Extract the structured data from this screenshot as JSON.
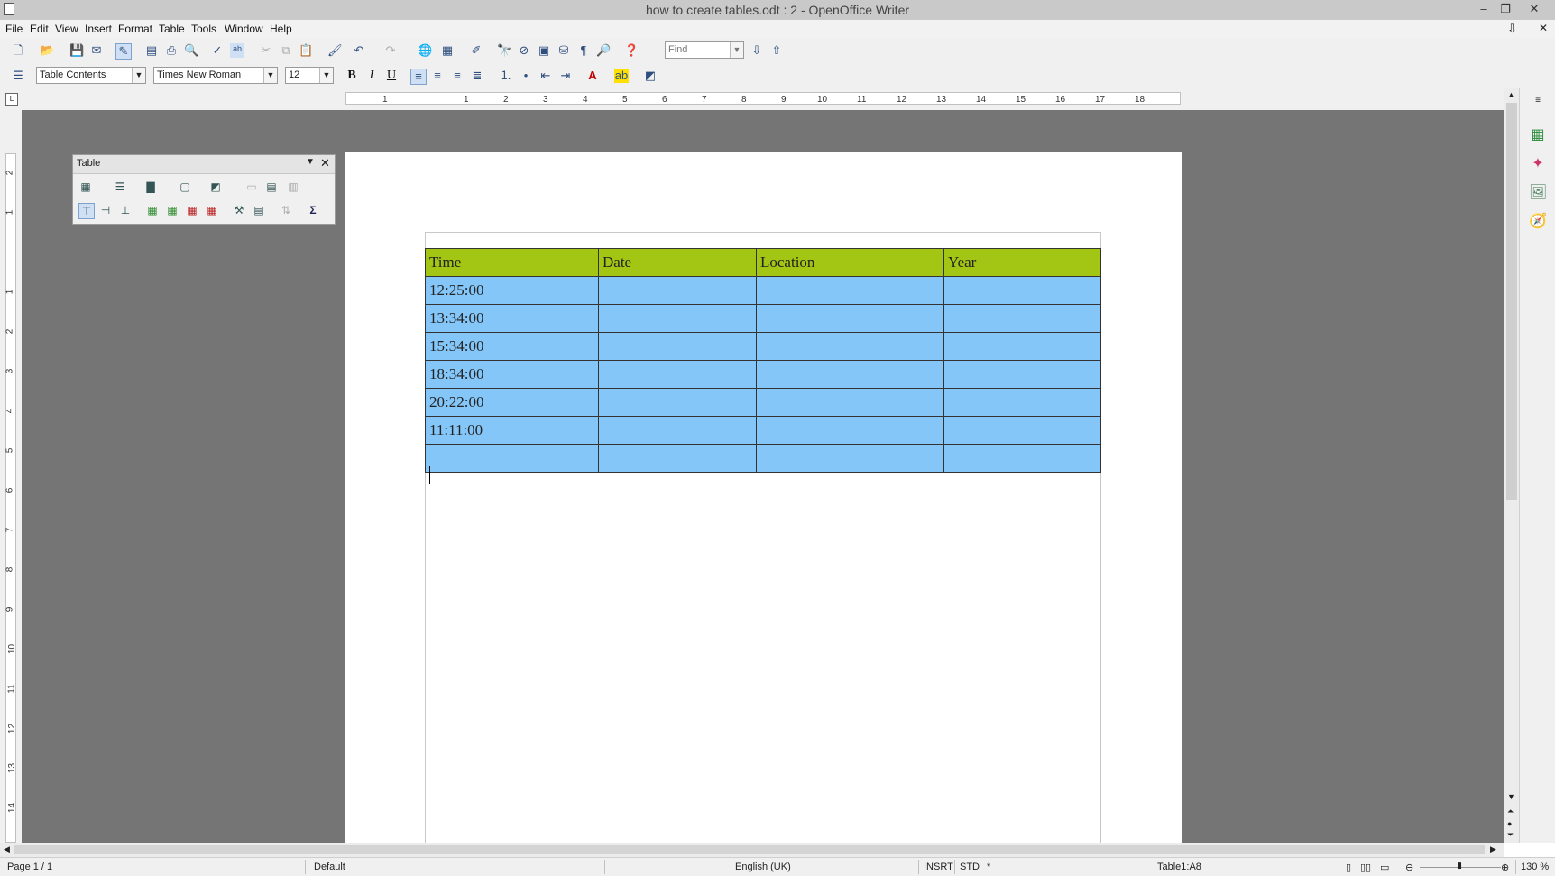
{
  "window": {
    "title": "how to create tables.odt : 2 - OpenOffice Writer",
    "minimize": "–",
    "restore": "❐",
    "close": "✕"
  },
  "menu": [
    "File",
    "Edit",
    "View",
    "Insert",
    "Format",
    "Table",
    "Tools",
    "Window",
    "Help"
  ],
  "toolbar": {
    "find_placeholder": "Find"
  },
  "formatting": {
    "style": "Table Contents",
    "font": "Times New Roman",
    "size": "12",
    "bold": "B",
    "italic": "I",
    "underline": "U"
  },
  "ruler": {
    "h_numbers": [
      "1",
      "1",
      "2",
      "3",
      "4",
      "5",
      "6",
      "7",
      "8",
      "9",
      "10",
      "11",
      "12",
      "13",
      "14",
      "15",
      "16",
      "17",
      "18"
    ],
    "v_numbers": [
      "2",
      "1",
      "1",
      "2",
      "3",
      "4",
      "5",
      "6",
      "7",
      "8",
      "9",
      "10",
      "11",
      "12",
      "13",
      "14"
    ]
  },
  "table_toolbar": {
    "title": "Table",
    "sum_icon": "Σ"
  },
  "document": {
    "headers": [
      "Time",
      "Date",
      "Location",
      "Year"
    ],
    "rows": [
      [
        "12:25:00",
        "",
        "",
        ""
      ],
      [
        "13:34:00",
        "",
        "",
        ""
      ],
      [
        "15:34:00",
        "",
        "",
        ""
      ],
      [
        "18:34:00",
        "",
        "",
        ""
      ],
      [
        "20:22:00",
        "",
        "",
        ""
      ],
      [
        "11:11:00",
        "",
        "",
        ""
      ],
      [
        "",
        "",
        "",
        ""
      ]
    ]
  },
  "status": {
    "page": "Page 1 / 1",
    "style": "Default",
    "language": "English (UK)",
    "insert_mode": "INSRT",
    "selection_mode": "STD",
    "modified": "*",
    "cell": "Table1:A8",
    "zoom": "130 %"
  },
  "colors": {
    "header_row": "#a3c514",
    "body_rows": "#84c6f8",
    "workspace": "#757575"
  },
  "icons": [
    "new-doc-icon",
    "open-icon",
    "save-icon",
    "email-icon",
    "edit-icon",
    "pdf-icon",
    "print-icon",
    "preview-icon",
    "spellcheck-icon",
    "autospell-icon",
    "cut-icon",
    "copy-icon",
    "paste-icon",
    "clone-icon",
    "undo-icon",
    "redo-icon",
    "hyperlink-icon",
    "table-icon",
    "draw-icon",
    "find-replace-icon",
    "navigator-icon",
    "gallery-icon",
    "datasource-icon",
    "nonprinting-icon",
    "zoom-icon",
    "help-icon"
  ]
}
